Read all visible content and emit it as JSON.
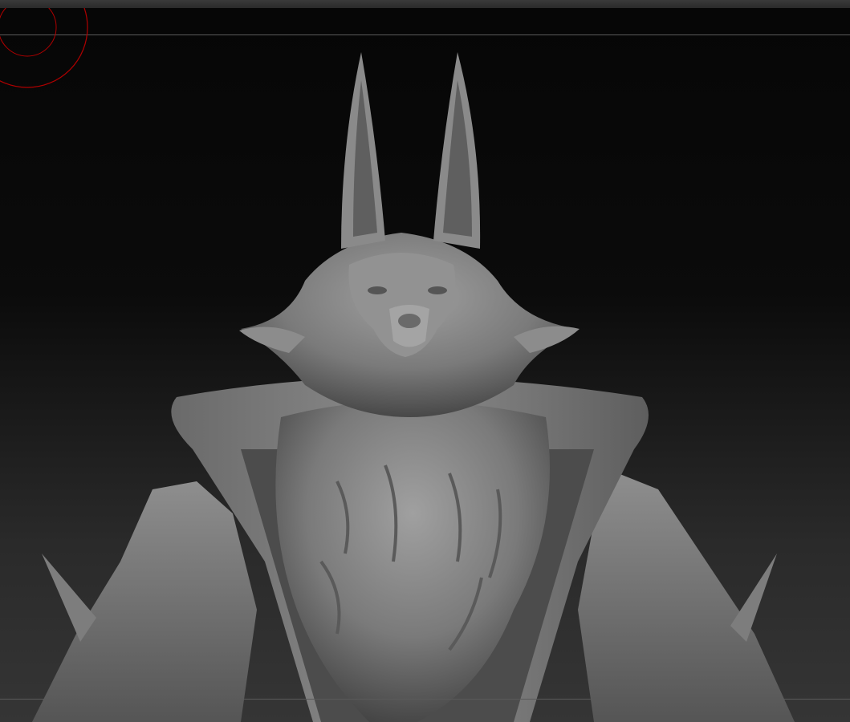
{
  "app": {
    "window_title": "",
    "canvas": {
      "background_top": "#060606",
      "background_bottom": "#353535",
      "brush_color": "#b00000",
      "model_material": "#8a8a8a"
    }
  },
  "viewport": {
    "content": "3d-sculpt-model",
    "icons": [
      "brush-cursor-icon"
    ]
  }
}
